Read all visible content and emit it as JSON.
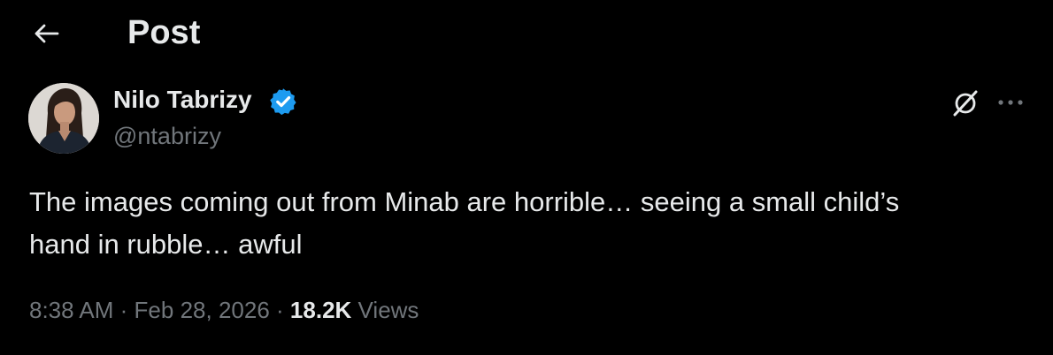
{
  "header": {
    "title": "Post",
    "back_icon": "back-arrow-icon"
  },
  "author": {
    "name": "Nilo Tabrizy",
    "handle": "@ntabrizy",
    "verified": true,
    "verified_color": "#1d9bf0"
  },
  "actions": {
    "grok_icon": "grok-icon",
    "more_icon": "more-icon"
  },
  "tweet": {
    "text": "The images coming out from Minab are horrible… seeing a small child’s\nhand in rubble… awful"
  },
  "meta": {
    "time": "8:38 AM",
    "separator": "·",
    "date": "Feb 28, 2026",
    "views_count": "18.2K",
    "views_label": "Views"
  },
  "colors": {
    "background": "#000000",
    "primary_text": "#e7e9ea",
    "secondary_text": "#71767b"
  }
}
